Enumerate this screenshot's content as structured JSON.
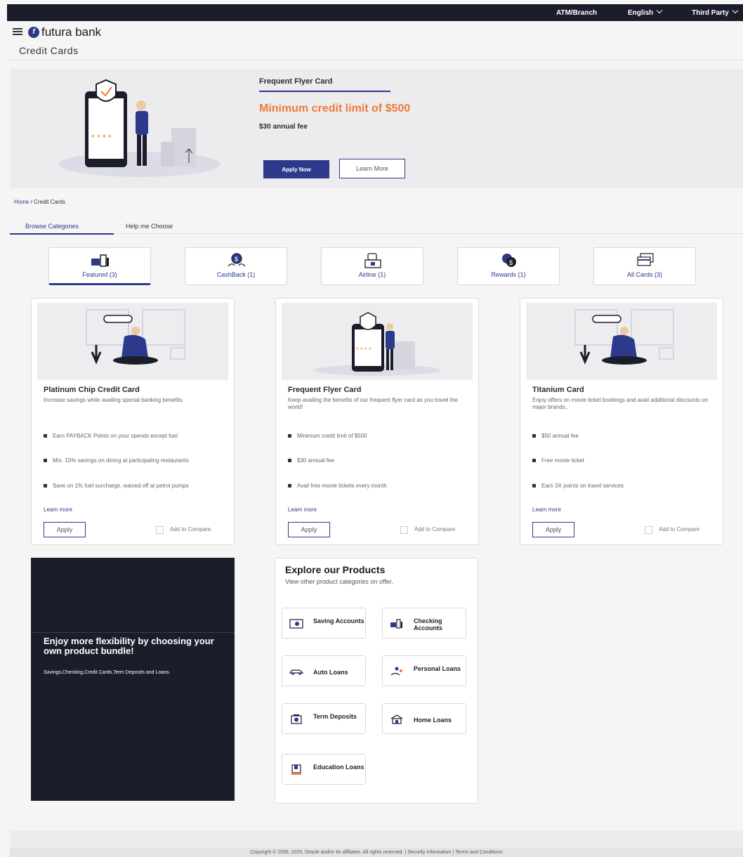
{
  "topbar": {
    "atm_branch": "ATM/Branch",
    "language": "English",
    "user": "Third Party"
  },
  "brand": {
    "name": "futura bank"
  },
  "page": {
    "title": "Credit Cards"
  },
  "hero": {
    "card_name": "Frequent Flyer Card",
    "headline": "Minimum credit limit of $500",
    "fee": "$30 annual fee",
    "apply_label": "Apply Now",
    "learn_label": "Learn More",
    "stars": "* * * *"
  },
  "breadcrumb": {
    "home": "Home",
    "separator": "/",
    "current": "Credit Cards"
  },
  "tabs": [
    {
      "label": "Browse Categories"
    },
    {
      "label": "Help me Choose"
    }
  ],
  "categories": [
    {
      "label": "Featured (3)",
      "icon": "card-reader-icon"
    },
    {
      "label": "CashBack (1)",
      "icon": "cashback-icon"
    },
    {
      "label": "Airline (1)",
      "icon": "airline-icon"
    },
    {
      "label": "Rewards (1)",
      "icon": "rewards-icon"
    },
    {
      "label": "All Cards (3)",
      "icon": "cards-stack-icon"
    }
  ],
  "cards": [
    {
      "title": "Platinum Chip Credit Card",
      "description": "Increase savings while availing special banking benefits.",
      "features": [
        "Earn PAYBACK Points on your spends except fuel",
        "Min. 15% savings on dining at participating restaurants",
        "Save on 1% fuel surcharge, waived off at petrol pumps"
      ],
      "learn_more": "Learn more",
      "apply": "Apply",
      "compare": "Add to Compare"
    },
    {
      "title": "Frequent Flyer Card",
      "description": "Keep availing the benefits of our frequent flyer card as you travel the world!",
      "features": [
        "Minimum credit limit of $500",
        "$30 annual fee",
        "Avail free movie tickets every month"
      ],
      "learn_more": "Learn more",
      "apply": "Apply",
      "compare": "Add to Compare"
    },
    {
      "title": "Titanium Card",
      "description": "Enjoy offers on movie ticket bookings and avail additional discounts on major brands..",
      "features": [
        "$50 annual fee",
        "Free movie ticket",
        "Earn 3X points on travel services"
      ],
      "learn_more": "Learn more",
      "apply": "Apply",
      "compare": "Add to Compare"
    }
  ],
  "promo": {
    "title": "Enjoy more flexibility by choosing your own product bundle!",
    "subtitle": "Savings,Checking,Credit Cards,Term Deposits and Loans."
  },
  "explore": {
    "title": "Explore our Products",
    "subtitle": "View other product categories on offer.",
    "products": [
      {
        "label": "Saving Accounts",
        "icon": "savings-icon"
      },
      {
        "label": "Checking Accounts",
        "icon": "checking-icon"
      },
      {
        "label": "Auto Loans",
        "icon": "car-icon"
      },
      {
        "label": "Personal Loans",
        "icon": "personal-loan-icon"
      },
      {
        "label": "Term Deposits",
        "icon": "term-deposit-icon"
      },
      {
        "label": "Home Loans",
        "icon": "home-icon"
      },
      {
        "label": "Education Loans",
        "icon": "education-icon"
      }
    ]
  },
  "footer": {
    "copyright": "Copyright © 2006, 2020, Oracle and/or its affiliates. All rights reserved. | Security Information | Terms and Conditions"
  },
  "colors": {
    "primary": "#2d3a8c",
    "accent": "#f07a3a",
    "dark": "#1c1d2b"
  }
}
